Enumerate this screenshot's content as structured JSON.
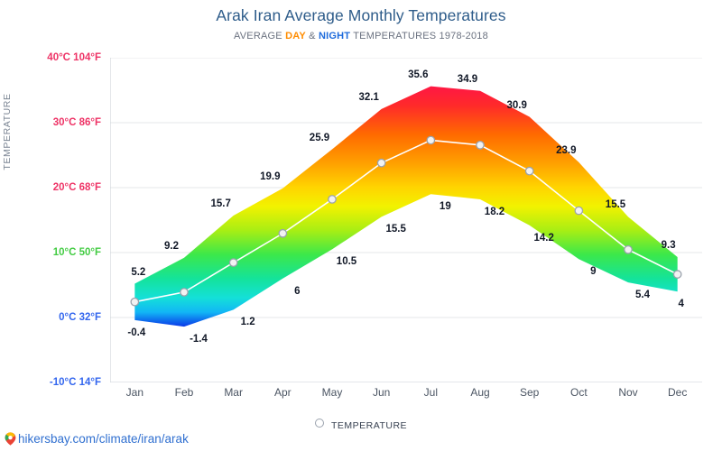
{
  "header": {
    "title": "Arak Iran Average Monthly Temperatures",
    "subtitle_pre": "AVERAGE ",
    "subtitle_day": "DAY",
    "subtitle_mid": " & ",
    "subtitle_night": "NIGHT",
    "subtitle_post": " TEMPERATURES 1978-2018"
  },
  "axis": {
    "y_title": "TEMPERATURE"
  },
  "legend": {
    "label": "TEMPERATURE",
    "marker": "circle-outline-icon"
  },
  "footer": {
    "icon": "map-pin-icon",
    "url": "hikersbay.com/climate/iran/arak"
  },
  "colors": {
    "title": "#2e5c8a",
    "day": "#ff8c00",
    "night": "#1e6bdc",
    "hot": "#ee3366",
    "mild": "#44cc44",
    "cold": "#3366ee",
    "grid": "#e4e7ea",
    "line": "#ffffff",
    "marker_fill": "#f2f2f2",
    "marker_stroke": "#9aa2ad",
    "label": "#111827",
    "footer_link": "#2f6fd0"
  },
  "chart_data": {
    "type": "area",
    "title": "Arak Iran Average Monthly Temperatures",
    "subtitle": "AVERAGE DAY & NIGHT TEMPERATURES 1978-2018",
    "xlabel": "",
    "ylabel": "TEMPERATURE",
    "ylim": [
      -10,
      40
    ],
    "grid": true,
    "legend_position": "bottom",
    "categories": [
      "Jan",
      "Feb",
      "Mar",
      "Apr",
      "May",
      "Jun",
      "Jul",
      "Aug",
      "Sep",
      "Oct",
      "Nov",
      "Dec"
    ],
    "yticks": [
      {
        "value": 40,
        "label": "40°C 104°F",
        "color": "#ee3366"
      },
      {
        "value": 30,
        "label": "30°C 86°F",
        "color": "#ee3366"
      },
      {
        "value": 20,
        "label": "20°C 68°F",
        "color": "#ee3366"
      },
      {
        "value": 10,
        "label": "10°C 50°F",
        "color": "#44cc44"
      },
      {
        "value": 0,
        "label": "0°C 32°F",
        "color": "#3366ee"
      },
      {
        "value": -10,
        "label": "-10°C 14°F",
        "color": "#3366ee"
      }
    ],
    "series": [
      {
        "name": "DAY",
        "role": "high",
        "values": [
          5.2,
          9.2,
          15.7,
          19.9,
          25.9,
          32.1,
          35.6,
          34.9,
          30.9,
          23.9,
          15.5,
          9.3
        ]
      },
      {
        "name": "NIGHT",
        "role": "low",
        "values": [
          -0.4,
          -1.4,
          1.2,
          6,
          10.5,
          15.5,
          19,
          18.2,
          14.2,
          9,
          5.4,
          4
        ]
      },
      {
        "name": "TEMPERATURE",
        "role": "average",
        "values": [
          2.4,
          3.9,
          8.45,
          12.95,
          18.2,
          23.8,
          27.3,
          26.55,
          22.55,
          16.45,
          10.45,
          6.65
        ]
      }
    ]
  }
}
